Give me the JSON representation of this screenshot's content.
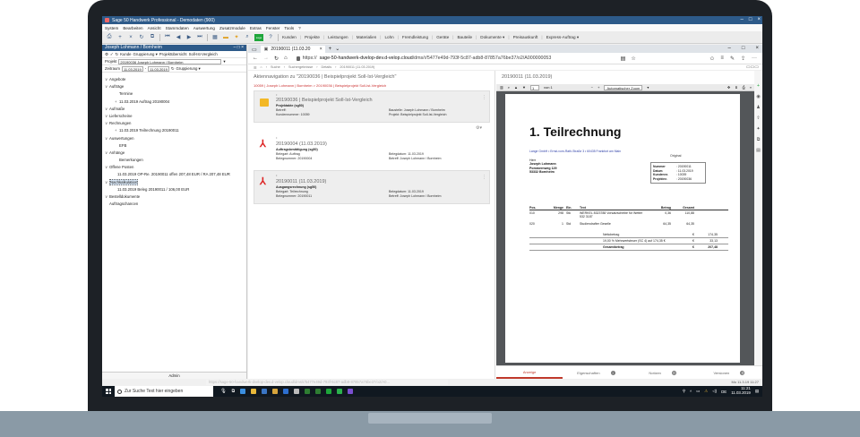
{
  "window": {
    "title": "Sage 50 Handwerk Professional - Demodaten (900)"
  },
  "menu": [
    "System",
    "Bearbeiten",
    "Ansicht",
    "Stammdaten",
    "Auswertung",
    "Zusatzmodule",
    "Extras",
    "Fenster",
    "Tools",
    "?"
  ],
  "toolbar": {
    "items": [
      "Kunden",
      "Projekte",
      "Leistungen",
      "Materialien",
      "Lohn",
      "Fremdleistung",
      "Geräte",
      "Bauteile",
      "Dokumente ▾",
      "Preisauskunft",
      "Express-Auftrag ▾"
    ]
  },
  "left_panel": {
    "title": "Joseph Lohmann / Bornheim",
    "row1": [
      "Kunde",
      "Gruppierung ▾",
      "Projektübersicht",
      "Soll-Ist-Vergleich"
    ],
    "projekt_label": "Projekt",
    "projekt_value": "20190036 Joseph Lohmann / Bornheim",
    "zeitraum_label": "Zeitraum",
    "date_from": "11.03.2019",
    "date_to": "11.03.2019",
    "gruppierung": "Gruppierung ▾",
    "tree": [
      {
        "level": 1,
        "text": "Angebote",
        "toggle": "∨"
      },
      {
        "level": 1,
        "text": "Aufträge",
        "toggle": "∨"
      },
      {
        "level": 3,
        "text": "Termine",
        "toggle": ""
      },
      {
        "level": 3,
        "text": "11.03.2019 Auftrag 20190004",
        "toggle": "+"
      },
      {
        "level": 1,
        "text": "Aufmaße",
        "toggle": "∨"
      },
      {
        "level": 1,
        "text": "Lieferscheine",
        "toggle": "∨"
      },
      {
        "level": 1,
        "text": "Rechnungen",
        "toggle": "∨"
      },
      {
        "level": 3,
        "text": "11.03.2019 Teilrechnung 20190011",
        "toggle": "+"
      },
      {
        "level": 1,
        "text": "Auswertungen",
        "toggle": "∨"
      },
      {
        "level": 3,
        "text": "EFB",
        "toggle": ""
      },
      {
        "level": 1,
        "text": "Anhänge",
        "toggle": "∨"
      },
      {
        "level": 3,
        "text": "Bemerkungen",
        "toggle": ""
      },
      {
        "level": 1,
        "text": "Offene Posten",
        "toggle": "∨"
      },
      {
        "level": 2,
        "text": "11.03.2019 OP-Re. 20190011 offen 207,48 EUR / RA 207,48 EUR",
        "toggle": ""
      },
      {
        "level": 1,
        "text": "Nachkalkulation",
        "toggle": "∨",
        "selected": true
      },
      {
        "level": 2,
        "text": "11.03.2019 Beleg 20190011 / 106,00 EUR",
        "toggle": ""
      },
      {
        "level": 1,
        "text": "Bestelldokumente",
        "toggle": "∨"
      },
      {
        "level": 1,
        "text": "Auftragschancen",
        "toggle": ""
      }
    ],
    "footer": "Admin"
  },
  "browser": {
    "tab_title": "20190011 (11.03.20",
    "url_prefix": "https://",
    "url_host": "sage-50-handwerk-dvelop-dev.d-velop.cloud",
    "url_path": "/dms/r/5477e49d-793f-5c87-adb8-87857a76be37/o2/A000000053",
    "breadcrumb": [
      "Suche",
      "Suchergebnisse",
      "Details",
      "20190011 (11.03.2019)"
    ],
    "status_url": "https://sage-50-handwerk-dvelop-dev.d-velop.cloud/dms/r/5477e49d-793f-5c87-adb8-87857a76be37/o2/A0..."
  },
  "left_pane": {
    "title": "Aktennavigation zu \"20190036 | Beispielprojekt Soll-Ist-Vergleich\"",
    "path": "10059 | Joseph Lohmann | Bornheim > 20190036 | Beispielprojekt Soll-Ist-Vergleich",
    "card_project": {
      "title": "20190036 | Beispielprojekt Soll-Ist-Vergleich",
      "subtitle": "Projektakte (sg50)",
      "k1": "Betreff:",
      "k2": "Kundennummer: 10059",
      "k3": "Baustelle: Joseph Lohmann / Bornheim",
      "k4": "Projekt: Beispielprojekt Soll-Ist-Vergleich"
    },
    "card_doc1": {
      "title": "20190004 (11.03.2019)",
      "subtitle": "Auftragsbestätigung (sg50)",
      "k1": "Belegart: Auftrag",
      "k2": "Belegnummer: 20190004",
      "k3": "Belegdatum: 11.03.2019",
      "k4": "Betreff: Joseph Lohmann / Bornheim"
    },
    "card_doc2": {
      "title": "20190011 (11.03.2019)",
      "subtitle": "Ausgangsrechnung (sg50)",
      "k1": "Belegart: Teilrechnung",
      "k2": "Belegnummer: 20190011",
      "k3": "Belegdatum: 11.03.2019",
      "k4": "Betreff: Joseph Lohmann / Bornheim"
    }
  },
  "right_pane": {
    "title": "20190011 (11.03.2019)",
    "page_of": "von 1",
    "zoom": "Automatischer Zoom",
    "doc": {
      "heading": "1. Teilrechnung",
      "company_line": "Lange GmbH • Ernst-vom-Rath-Straße 3 • 60435 Frankfurt am Main",
      "addr": [
        "Herr",
        "Joseph Lohmann",
        "Pommernweg 129",
        "53332 Bornheim"
      ],
      "original": "Original",
      "meta": [
        {
          "k": "Nummer",
          "v": ": 20190011"
        },
        {
          "k": "Datum",
          "v": ": 11.03.2019"
        },
        {
          "k": "Kundennr.",
          "v": ": 10039"
        },
        {
          "k": "Projektnr.",
          "v": ": 20190036"
        }
      ],
      "columns": [
        "Pos.",
        "Menge",
        "Ein.",
        "Text",
        "Betrag",
        "Gesamt"
      ],
      "rows": [
        {
          "pos": "010",
          "menge": "298",
          "ein": "Stk",
          "text": "WERKEL 8323788 Vorsatzscheibe für Wetter 532 3187",
          "betrag": "0,36",
          "gesamt": "110,88"
        },
        {
          "pos": "020",
          "menge": "1",
          "ein": "Std",
          "text": "Studiendrafter Geselle",
          "betrag": "64,35",
          "gesamt": "64,35"
        }
      ],
      "totals": [
        {
          "label": "Nettobetrag",
          "cur": "€",
          "val": "174,35"
        },
        {
          "label": "19,00 % Mehrwertsteuer (SC 4) auf 174,35 €",
          "cur": "€",
          "val": "33,13"
        },
        {
          "label": "Gesamtbetrag",
          "cur": "€",
          "val": "207,48"
        }
      ]
    },
    "tabs": [
      {
        "label": "Anzeige",
        "badge": ""
      },
      {
        "label": "Eigenschaften",
        "badge": "i"
      },
      {
        "label": "Notizen",
        "badge": "0"
      },
      {
        "label": "Versionen",
        "badge": "0"
      }
    ]
  },
  "taskbar": {
    "search_placeholder": "Zur Suche Text hier eingeben",
    "time": "11:21",
    "date": "11.03.2019",
    "notice": "Mo 11.3.19 11:27"
  }
}
